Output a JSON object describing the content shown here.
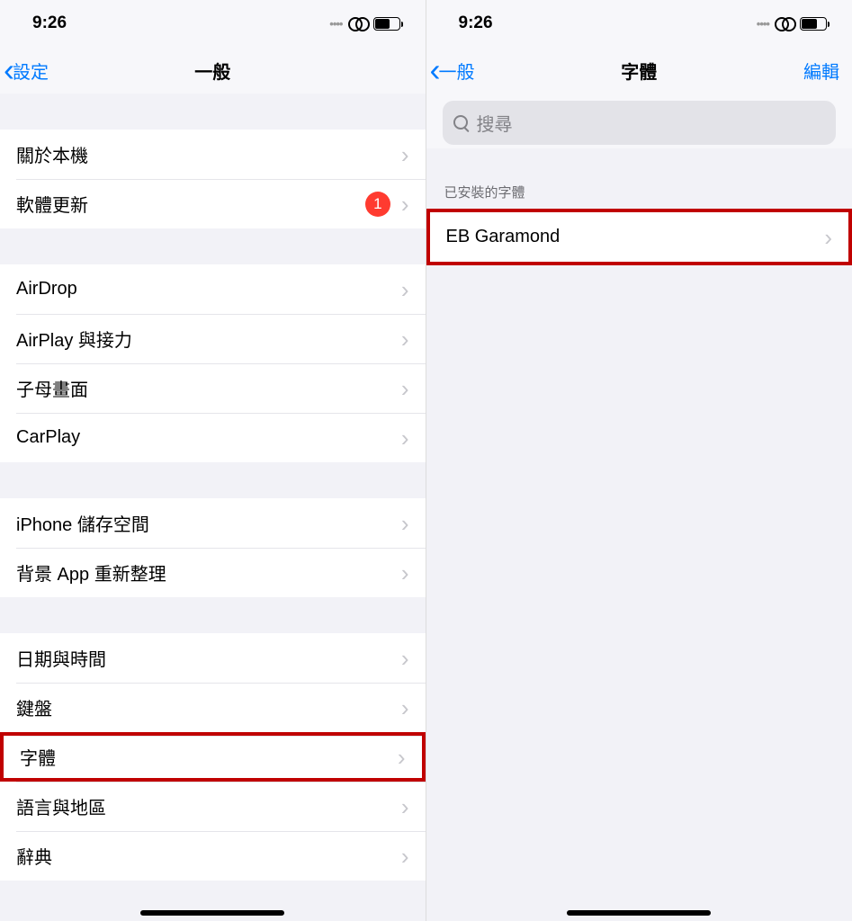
{
  "left": {
    "status": {
      "time": "9:26"
    },
    "nav": {
      "back": "設定",
      "title": "一般"
    },
    "groups": [
      {
        "items": [
          {
            "key": "about",
            "label": "關於本機"
          },
          {
            "key": "sw_update",
            "label": "軟體更新",
            "badge": "1"
          }
        ]
      },
      {
        "items": [
          {
            "key": "airdrop",
            "label": "AirDrop"
          },
          {
            "key": "airplay",
            "label": "AirPlay 與接力"
          },
          {
            "key": "pip",
            "label": "子母畫面"
          },
          {
            "key": "carplay",
            "label": "CarPlay"
          }
        ]
      },
      {
        "items": [
          {
            "key": "storage",
            "label": "iPhone 儲存空間"
          },
          {
            "key": "bg_refresh",
            "label": "背景 App 重新整理"
          }
        ]
      },
      {
        "items": [
          {
            "key": "datetime",
            "label": "日期與時間"
          },
          {
            "key": "keyboard",
            "label": "鍵盤"
          },
          {
            "key": "fonts",
            "label": "字體",
            "highlight": true
          },
          {
            "key": "lang",
            "label": "語言與地區"
          },
          {
            "key": "dict",
            "label": "辭典"
          }
        ]
      }
    ]
  },
  "right": {
    "status": {
      "time": "9:26"
    },
    "nav": {
      "back": "一般",
      "title": "字體",
      "right": "編輯"
    },
    "search_placeholder": "搜尋",
    "section_header": "已安裝的字體",
    "fonts": [
      {
        "name": "EB Garamond",
        "highlight": true
      }
    ]
  }
}
